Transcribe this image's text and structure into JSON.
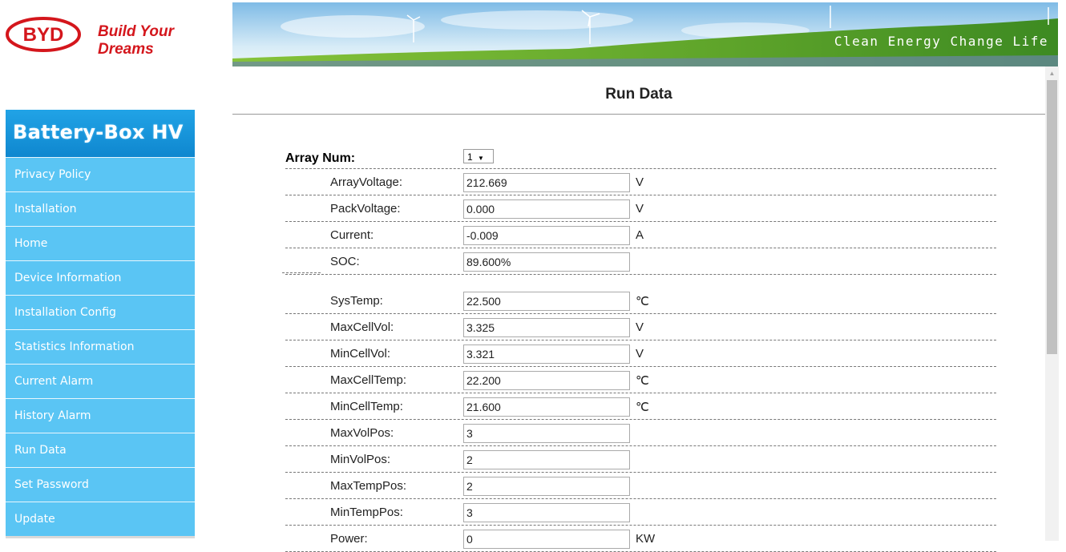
{
  "header": {
    "logo_letters": "BYD",
    "tagline": "Build Your Dreams",
    "slogan": "Clean Energy Change Life"
  },
  "sidebar": {
    "title": "Battery-Box HV",
    "items": [
      {
        "label": "Privacy Policy"
      },
      {
        "label": "Installation"
      },
      {
        "label": "Home"
      },
      {
        "label": "Device Information"
      },
      {
        "label": "Installation Config"
      },
      {
        "label": "Statistics Information"
      },
      {
        "label": "Current Alarm"
      },
      {
        "label": "History Alarm"
      },
      {
        "label": "Run Data"
      },
      {
        "label": "Set Password"
      },
      {
        "label": "Update"
      }
    ]
  },
  "main": {
    "title": "Run Data",
    "array_num_label": "Array Num:",
    "array_num_value": "1",
    "rows": [
      {
        "label": "ArrayVoltage:",
        "value": "212.669",
        "unit": "V"
      },
      {
        "label": "PackVoltage:",
        "value": "0.000",
        "unit": "V"
      },
      {
        "label": "Current:",
        "value": "-0.009",
        "unit": "A"
      },
      {
        "label": "SOC:",
        "value": "89.600%",
        "unit": ""
      },
      {
        "label": "SysTemp:",
        "value": "22.500",
        "unit": "℃"
      },
      {
        "label": "MaxCellVol:",
        "value": "3.325",
        "unit": "V"
      },
      {
        "label": "MinCellVol:",
        "value": "3.321",
        "unit": "V"
      },
      {
        "label": "MaxCellTemp:",
        "value": "22.200",
        "unit": "℃"
      },
      {
        "label": "MinCellTemp:",
        "value": "21.600",
        "unit": "℃"
      },
      {
        "label": "MaxVolPos:",
        "value": "3",
        "unit": ""
      },
      {
        "label": "MinVolPos:",
        "value": "2",
        "unit": ""
      },
      {
        "label": "MaxTempPos:",
        "value": "2",
        "unit": ""
      },
      {
        "label": "MinTempPos:",
        "value": "3",
        "unit": ""
      },
      {
        "label": "Power:",
        "value": "0",
        "unit": "KW"
      }
    ]
  },
  "colors": {
    "brand_red": "#d4161c",
    "sidebar_head": "#1598da",
    "sidebar_item": "#5ac5f4"
  }
}
